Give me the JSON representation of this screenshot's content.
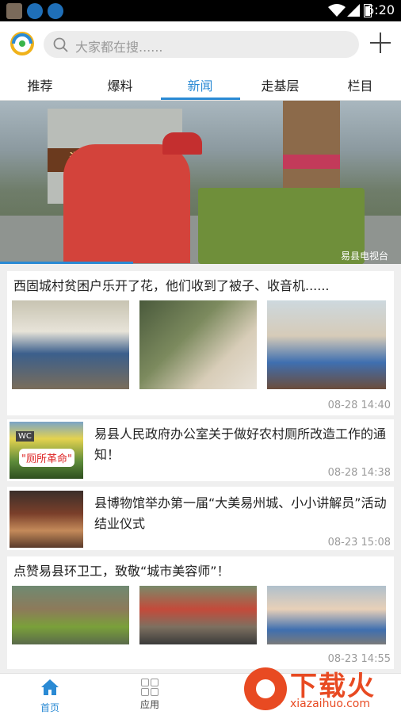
{
  "status_bar": {
    "time": "6:20"
  },
  "header": {
    "search_placeholder": "大家都在搜......"
  },
  "tabs": [
    {
      "label": "推荐"
    },
    {
      "label": "爆料"
    },
    {
      "label": "新闻"
    },
    {
      "label": "走基层"
    },
    {
      "label": "栏目"
    }
  ],
  "active_tab": "新闻",
  "banner": {
    "source": "易县电视台"
  },
  "news": [
    {
      "title": "西固城村贫困户乐开了花，他们收到了被子、收音机......",
      "date": "08-28 14:40"
    },
    {
      "title": "易县人民政府办公室关于做好农村厕所改造工作的通知！",
      "date": "08-28 14:38",
      "thumb_caption": "\"厕所革命\""
    },
    {
      "title": "县博物馆举办第一届“大美易州城、小小讲解员”活动结业仪式",
      "date": "08-23 15:08"
    },
    {
      "title": "点赞易县环卫工，致敬“城市美容师”！",
      "date": "08-23 14:55"
    }
  ],
  "bottom_nav": {
    "home": "首页",
    "apps": "应用"
  },
  "watermark": {
    "brand": "下载火",
    "url": "xiazaihuo.com"
  },
  "colors": {
    "accent": "#2a8ad4",
    "watermark": "#e84a22"
  }
}
